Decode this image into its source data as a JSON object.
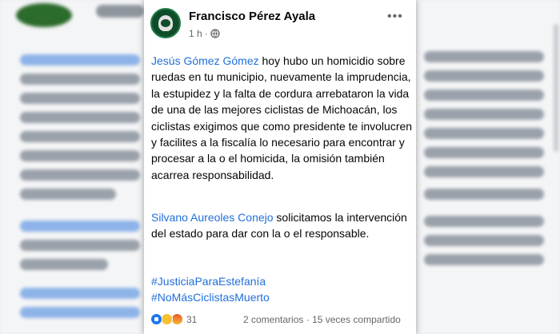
{
  "post": {
    "author": "Francisco Pérez Ayala",
    "time": "1 h",
    "separator": "·",
    "mention1": "Jesús Gómez Gómez",
    "text1": " hoy hubo un homicidio sobre ruedas en tu municipio, nuevamente la imprudencia, la estupidez y la falta de cordura arrebataron la vida de una de las mejores ciclistas de Michoacán, los ciclistas exigimos que como presidente te involucren y facilites a la fiscalía lo necesario para encontrar y procesar a la o el homicida, la omisión también acarrea responsabilidad.",
    "mention2": "Silvano Aureoles Conejo",
    "text2": " solicitamos la intervención del estado para dar con la o el responsable.",
    "hashtags": [
      "#JusticiaParaEstefanía",
      "#NoMásCiclistasMuerto"
    ],
    "reactions_count": "31",
    "comments": "2 comentarios",
    "dot": "·",
    "shares": "15 veces compartido"
  },
  "icons": {
    "privacy": "globe-icon",
    "menu": "more-options-icon",
    "reactions": [
      "like-icon",
      "sad-icon",
      "angry-icon"
    ]
  },
  "colors": {
    "link": "#216fdb",
    "text": "#050505",
    "muted": "#65676b"
  }
}
